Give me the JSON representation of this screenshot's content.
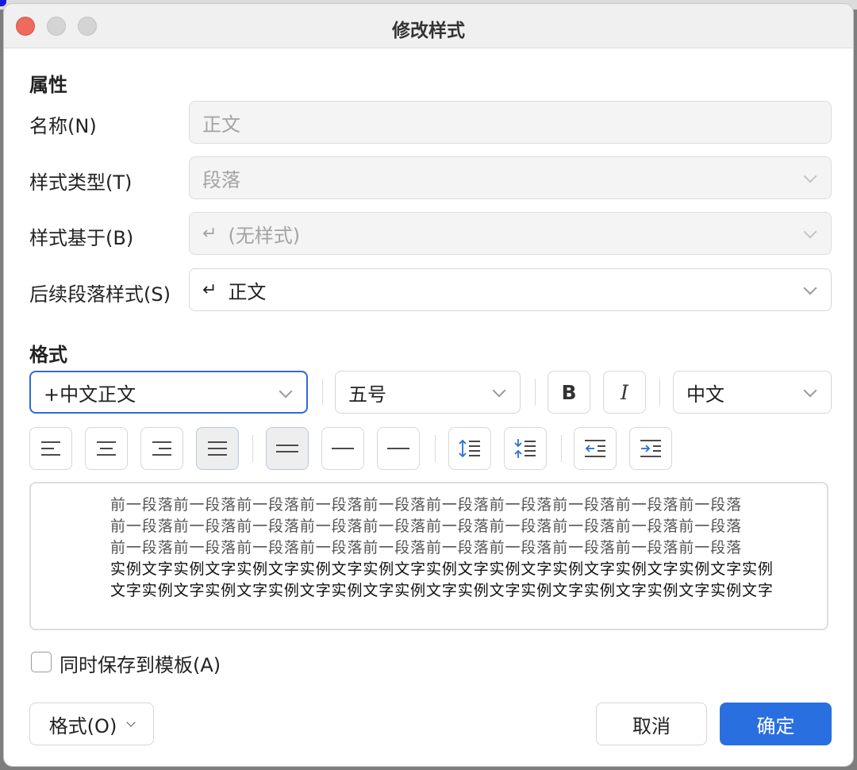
{
  "window": {
    "title": "修改样式"
  },
  "properties": {
    "heading": "属性",
    "name": {
      "label": "名称(N)",
      "value": "正文"
    },
    "style_type": {
      "label": "样式类型(T)",
      "value": "段落"
    },
    "based_on": {
      "label": "样式基于(B)",
      "value": "(无样式)"
    },
    "next_style": {
      "label": "后续段落样式(S)",
      "value": "正文"
    }
  },
  "format": {
    "heading": "格式",
    "font_name": "+中文正文",
    "font_size": "五号",
    "bold_label": "B",
    "italic_label": "I",
    "script": "中文"
  },
  "alignment": {
    "active": "justify",
    "line_spacing_active": "single"
  },
  "preview": {
    "previous_lines": [
      "前一段落前一段落前一段落前一段落前一段落前一段落前一段落前一段落前一段落前一段落",
      "前一段落前一段落前一段落前一段落前一段落前一段落前一段落前一段落前一段落前一段落",
      "前一段落前一段落前一段落前一段落前一段落前一段落前一段落前一段落前一段落前一段落"
    ],
    "sample_lines": [
      "实例文字实例文字实例文字实例文字实例文字实例文字实例文字实例文字实例文字实例文字实例",
      "文字实例文字实例文字实例文字实例文字实例文字实例文字实例文字实例文字实例文字实例文字"
    ]
  },
  "save_to_template": {
    "label": "同时保存到模板(A)",
    "checked": false
  },
  "buttons": {
    "format": "格式(O)",
    "cancel": "取消",
    "ok": "确定"
  },
  "colors": {
    "accent": "#2a6fe0",
    "focus_border": "#2f6ad8",
    "close": "#ed6a5e"
  }
}
